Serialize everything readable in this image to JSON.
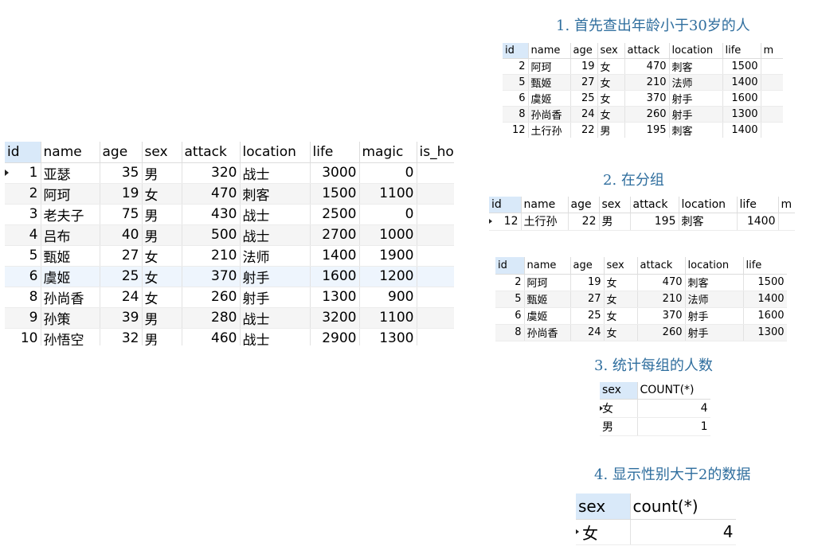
{
  "captions": {
    "step1": "1. 首先查出年龄小于30岁的人",
    "step2": "2. 在分组",
    "step3": "3. 统计每组的人数",
    "step4": "4. 显示性别大于2的数据"
  },
  "main_table": {
    "columns": [
      "id",
      "name",
      "age",
      "sex",
      "attack",
      "location",
      "life",
      "magic",
      "is_hot"
    ],
    "rows": [
      {
        "id": "1",
        "name": "亚瑟",
        "age": "35",
        "sex": "男",
        "attack": "320",
        "location": "战士",
        "life": "3000",
        "magic": "0"
      },
      {
        "id": "2",
        "name": "阿珂",
        "age": "19",
        "sex": "女",
        "attack": "470",
        "location": "刺客",
        "life": "1500",
        "magic": "1100"
      },
      {
        "id": "3",
        "name": "老夫子",
        "age": "75",
        "sex": "男",
        "attack": "430",
        "location": "战士",
        "life": "2500",
        "magic": "0"
      },
      {
        "id": "4",
        "name": "吕布",
        "age": "40",
        "sex": "男",
        "attack": "500",
        "location": "战士",
        "life": "2700",
        "magic": "1000"
      },
      {
        "id": "5",
        "name": "甄姬",
        "age": "27",
        "sex": "女",
        "attack": "210",
        "location": "法师",
        "life": "1400",
        "magic": "1900"
      },
      {
        "id": "6",
        "name": "虞姬",
        "age": "25",
        "sex": "女",
        "attack": "370",
        "location": "射手",
        "life": "1600",
        "magic": "1200"
      },
      {
        "id": "8",
        "name": "孙尚香",
        "age": "24",
        "sex": "女",
        "attack": "260",
        "location": "射手",
        "life": "1300",
        "magic": "900"
      },
      {
        "id": "9",
        "name": "孙策",
        "age": "39",
        "sex": "男",
        "attack": "280",
        "location": "战士",
        "life": "3200",
        "magic": "1100"
      },
      {
        "id": "10",
        "name": "孙悟空",
        "age": "32",
        "sex": "男",
        "attack": "460",
        "location": "战士",
        "life": "2900",
        "magic": "1300"
      }
    ]
  },
  "under30_table": {
    "columns": [
      "id",
      "name",
      "age",
      "sex",
      "attack",
      "location",
      "life",
      "m"
    ],
    "rows": [
      {
        "id": "2",
        "name": "阿珂",
        "age": "19",
        "sex": "女",
        "attack": "470",
        "location": "刺客",
        "life": "1500"
      },
      {
        "id": "5",
        "name": "甄姬",
        "age": "27",
        "sex": "女",
        "attack": "210",
        "location": "法师",
        "life": "1400"
      },
      {
        "id": "6",
        "name": "虞姬",
        "age": "25",
        "sex": "女",
        "attack": "370",
        "location": "射手",
        "life": "1600"
      },
      {
        "id": "8",
        "name": "孙尚香",
        "age": "24",
        "sex": "女",
        "attack": "260",
        "location": "射手",
        "life": "1300"
      },
      {
        "id": "12",
        "name": "土行孙",
        "age": "22",
        "sex": "男",
        "attack": "195",
        "location": "刺客",
        "life": "1400"
      }
    ]
  },
  "group_male_table": {
    "columns": [
      "id",
      "name",
      "age",
      "sex",
      "attack",
      "location",
      "life",
      "m"
    ],
    "rows": [
      {
        "id": "12",
        "name": "土行孙",
        "age": "22",
        "sex": "男",
        "attack": "195",
        "location": "刺客",
        "life": "1400"
      }
    ]
  },
  "group_female_table": {
    "columns": [
      "id",
      "name",
      "age",
      "sex",
      "attack",
      "location",
      "life"
    ],
    "rows": [
      {
        "id": "2",
        "name": "阿珂",
        "age": "19",
        "sex": "女",
        "attack": "470",
        "location": "刺客",
        "life": "1500"
      },
      {
        "id": "5",
        "name": "甄姬",
        "age": "27",
        "sex": "女",
        "attack": "210",
        "location": "法师",
        "life": "1400"
      },
      {
        "id": "6",
        "name": "虞姬",
        "age": "25",
        "sex": "女",
        "attack": "370",
        "location": "射手",
        "life": "1600"
      },
      {
        "id": "8",
        "name": "孙尚香",
        "age": "24",
        "sex": "女",
        "attack": "260",
        "location": "射手",
        "life": "1300"
      }
    ]
  },
  "count_table": {
    "columns": [
      "sex",
      "COUNT(*)"
    ],
    "rows": [
      {
        "sex": "女",
        "count": "4"
      },
      {
        "sex": "男",
        "count": "1"
      }
    ]
  },
  "having_table": {
    "columns": [
      "sex",
      "count(*)"
    ],
    "rows": [
      {
        "sex": "女",
        "count": "4"
      }
    ]
  }
}
